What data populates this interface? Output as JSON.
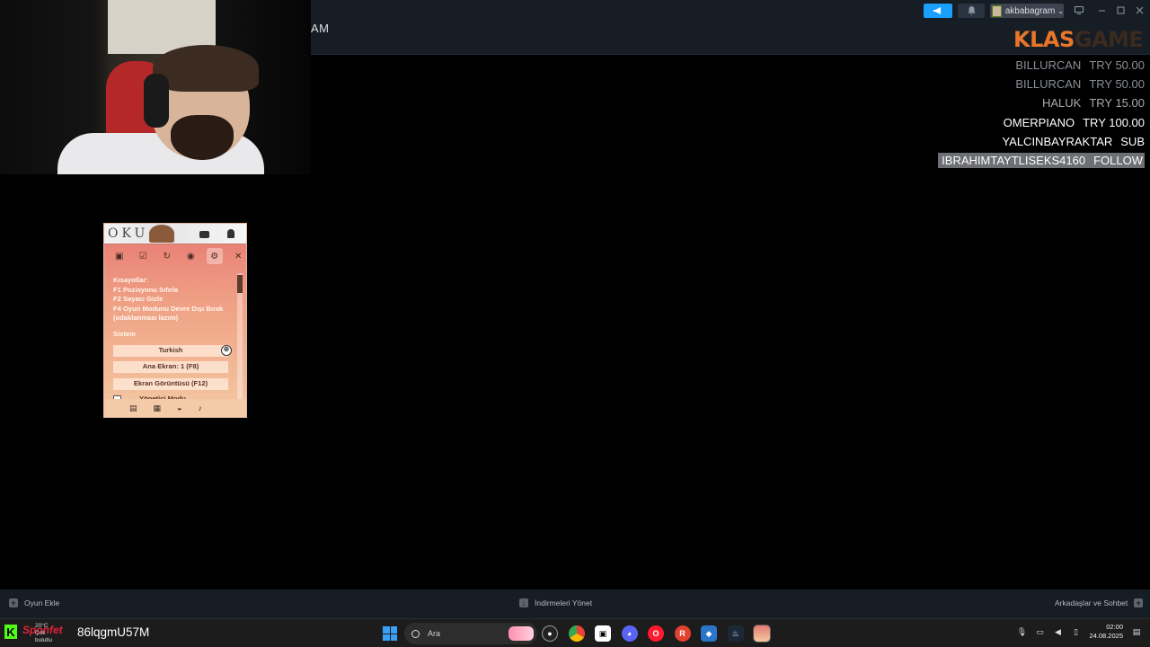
{
  "steam_header": {
    "title_fragment": "AM",
    "username": "akbabagram",
    "user_chevron": "⌄"
  },
  "logo": {
    "part1": "KLAS",
    "part2": "GAME"
  },
  "feed": [
    {
      "name": "BILLURCAN",
      "amount": "TRY 50.00",
      "style": "dim1"
    },
    {
      "name": "BILLURCAN",
      "amount": "TRY 50.00",
      "style": "dim1"
    },
    {
      "name": "HALUK",
      "amount": "TRY 15.00",
      "style": "dim2"
    },
    {
      "name": "OMERPIANO",
      "amount": "TRY 100.00",
      "style": "bright"
    },
    {
      "name": "YALCINBAYRAKTAR",
      "amount": "SUB",
      "style": "bright"
    },
    {
      "name": "IBRAHIMTAYTLISEKS4160",
      "amount": "FOLLOW",
      "style": "hl"
    }
  ],
  "overlay": {
    "brand": "OKU",
    "close": "✕",
    "shortcuts_title": "Kısayollar:",
    "shortcut_f1": "F1 Pozisyonu Sıfırla",
    "shortcut_f2": "F2 Sayacı Gizle",
    "shortcut_f4": "F4 Oyun Modunu Devre Dışı Bırak (odaklanması lazım)",
    "section_system": "Sistem",
    "language_button": "Turkish",
    "main_screen_button": "Ana Ekran: 1 (F8)",
    "screenshot_button": "Ekran Görüntüsü (F12)",
    "admin_mode_label": "Yönetici Modu"
  },
  "bottom_bar": {
    "add_game": "Oyun Ekle",
    "manage_downloads": "İndirmeleri Yönet",
    "friends_chat": "Arkadaşlar ve Sohbet"
  },
  "taskbar": {
    "sponsor": "Sponfet",
    "weather_temp": "20°C",
    "weather_desc": "Çok bulutlu",
    "stream_code": "86lqgmU57M",
    "search_placeholder": "Ara",
    "time": "02:00",
    "date": "24.08.2025"
  },
  "colors": {
    "steam_blue": "#1a9fff",
    "klas_orange": "#e8762a",
    "kick_green": "#53fc18"
  }
}
